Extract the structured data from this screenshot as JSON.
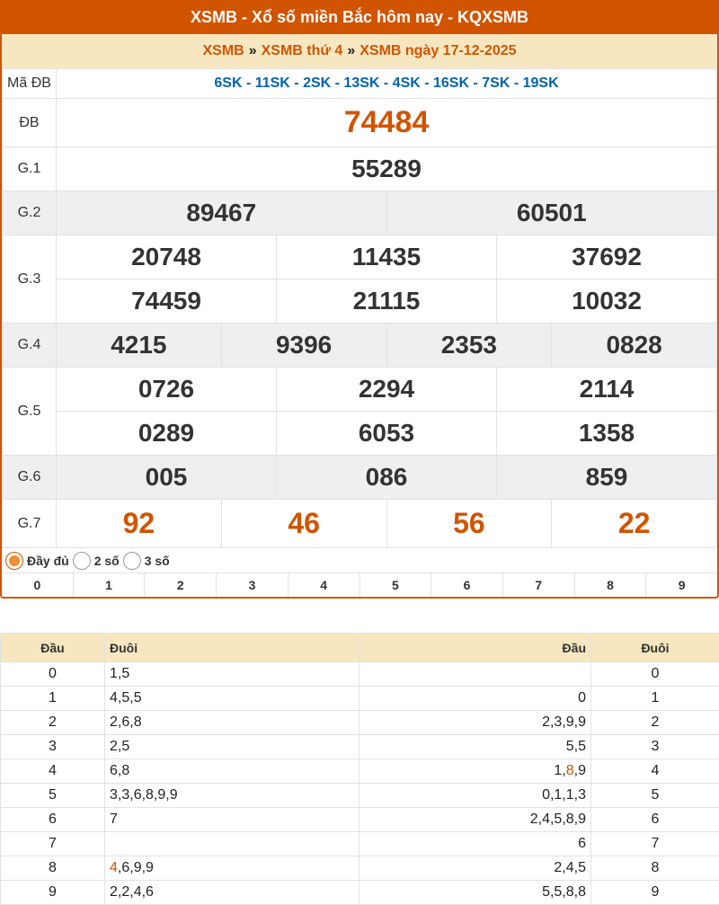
{
  "header": {
    "title": "XSMB - Xổ số miền Bắc hôm nay - KQXSMB"
  },
  "breadcrumb": {
    "home": "XSMB",
    "weekday": "XSMB thứ 4",
    "date": "XSMB ngày 17-12-2025",
    "sep": "»"
  },
  "results": {
    "ma_db_label": "Mã ĐB",
    "ma_db": "6SK - 11SK - 2SK - 13SK - 4SK - 16SK - 7SK - 19SK",
    "db": {
      "label": "ĐB",
      "numbers": [
        "74484"
      ]
    },
    "g1": {
      "label": "G.1",
      "numbers": [
        "55289"
      ]
    },
    "g2": {
      "label": "G.2",
      "numbers": [
        "89467",
        "60501"
      ]
    },
    "g3": {
      "label": "G.3",
      "numbers": [
        "20748",
        "11435",
        "37692",
        "74459",
        "21115",
        "10032"
      ]
    },
    "g4": {
      "label": "G.4",
      "numbers": [
        "4215",
        "9396",
        "2353",
        "0828"
      ]
    },
    "g5": {
      "label": "G.5",
      "numbers": [
        "0726",
        "2294",
        "2114",
        "0289",
        "6053",
        "1358"
      ]
    },
    "g6": {
      "label": "G.6",
      "numbers": [
        "005",
        "086",
        "859"
      ]
    },
    "g7": {
      "label": "G.7",
      "numbers": [
        "92",
        "46",
        "56",
        "22"
      ]
    }
  },
  "display_options": [
    {
      "label": "Đầy đủ",
      "selected": true
    },
    {
      "label": "2 số",
      "selected": false
    },
    {
      "label": "3 số",
      "selected": false
    }
  ],
  "digit_filter": [
    "0",
    "1",
    "2",
    "3",
    "4",
    "5",
    "6",
    "7",
    "8",
    "9"
  ],
  "loto": {
    "headers": {
      "dau": "Đầu",
      "duoi": "Đuôi",
      "dau2": "Đầu",
      "duoi2": "Đuôi"
    },
    "rows": [
      {
        "dau": "0",
        "duoi": [
          "1,5"
        ],
        "dau2": [
          ""
        ],
        "duoi2": "0"
      },
      {
        "dau": "1",
        "duoi": [
          "4,5,5"
        ],
        "dau2": [
          "0"
        ],
        "duoi2": "1"
      },
      {
        "dau": "2",
        "duoi": [
          "2,6,8"
        ],
        "dau2": [
          "2,3,9,9"
        ],
        "duoi2": "2"
      },
      {
        "dau": "3",
        "duoi": [
          "2,5"
        ],
        "dau2": [
          "5,5"
        ],
        "duoi2": "3"
      },
      {
        "dau": "4",
        "duoi": [
          "6,8"
        ],
        "dau2": [
          "1,",
          "8",
          ",9"
        ],
        "duoi2": "4"
      },
      {
        "dau": "5",
        "duoi": [
          "3,3,6,8,9,9"
        ],
        "dau2": [
          "0,1,1,3"
        ],
        "duoi2": "5"
      },
      {
        "dau": "6",
        "duoi": [
          "7"
        ],
        "dau2": [
          "2,4,5,8,9"
        ],
        "duoi2": "6"
      },
      {
        "dau": "7",
        "duoi": [
          ""
        ],
        "dau2": [
          "6"
        ],
        "duoi2": "7"
      },
      {
        "dau": "8",
        "duoi": [
          "4",
          ",6,9,9"
        ],
        "dau2": [
          "2,4,5"
        ],
        "duoi2": "8"
      },
      {
        "dau": "9",
        "duoi": [
          "2,2,4,6"
        ],
        "dau2": [
          "5,5,8,8"
        ],
        "duoi2": "9"
      }
    ]
  },
  "colors": {
    "brand": "#d15400",
    "header_bg": "#f7e7c0",
    "code_blue": "#0063b0",
    "row_shade": "#efefef"
  }
}
